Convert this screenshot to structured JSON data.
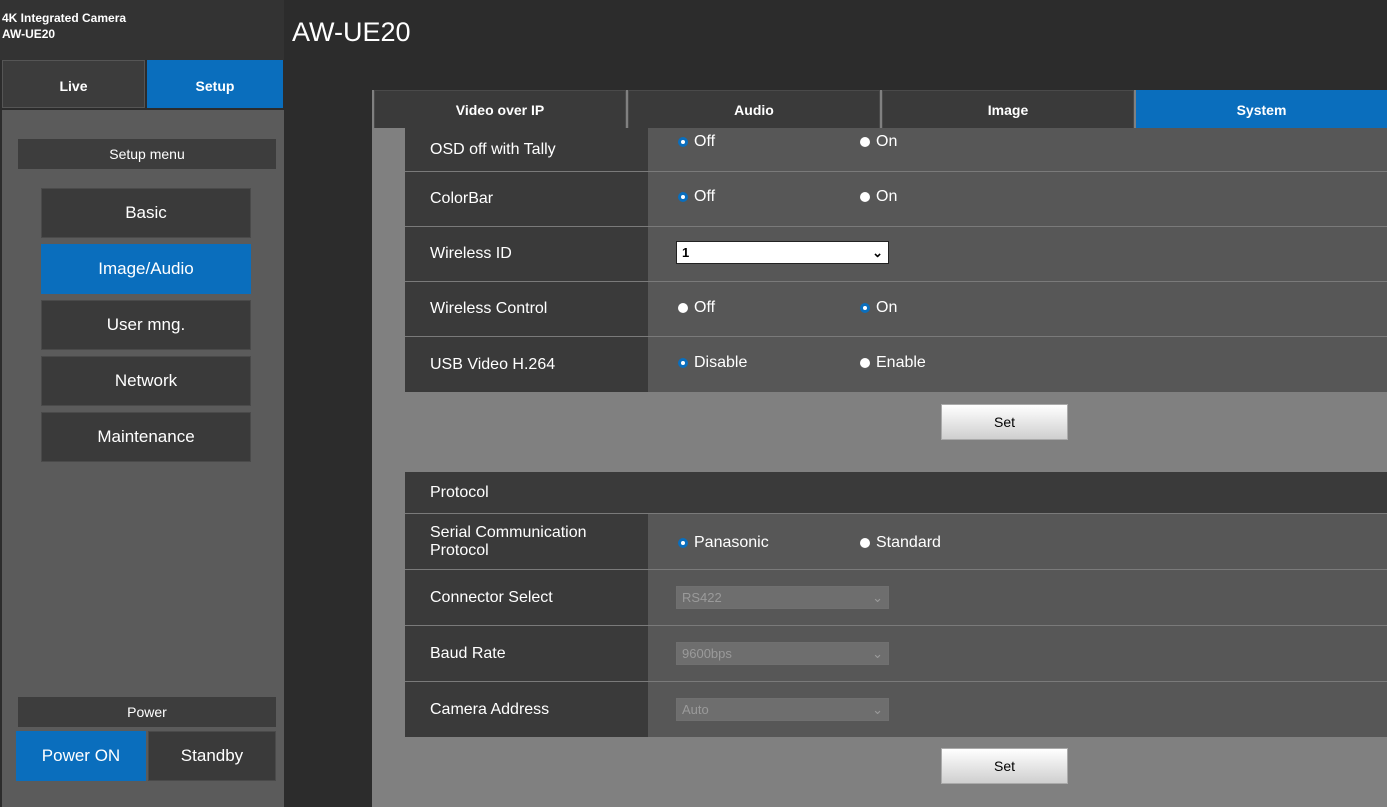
{
  "header": {
    "brand_line1": "4K Integrated Camera",
    "brand_line2": "AW-UE20",
    "model_title": "AW-UE20"
  },
  "mode_tabs": {
    "live": "Live",
    "setup": "Setup",
    "active": "Setup"
  },
  "sidebar": {
    "setup_menu_title": "Setup menu",
    "items": [
      {
        "label": "Basic"
      },
      {
        "label": "Image/Audio"
      },
      {
        "label": "User mng."
      },
      {
        "label": "Network"
      },
      {
        "label": "Maintenance"
      }
    ],
    "active_item": "Image/Audio",
    "power_title": "Power",
    "power_on": "Power ON",
    "standby": "Standby"
  },
  "tabs": [
    {
      "label": "Video over IP"
    },
    {
      "label": "Audio"
    },
    {
      "label": "Image"
    },
    {
      "label": "System"
    }
  ],
  "active_tab": "System",
  "settings": {
    "osd_off_with_tally": {
      "label": "OSD off with Tally",
      "options": [
        "Off",
        "On"
      ],
      "selected": "Off"
    },
    "colorbar": {
      "label": "ColorBar",
      "options": [
        "Off",
        "On"
      ],
      "selected": "Off"
    },
    "wireless_id": {
      "label": "Wireless ID",
      "value": "1"
    },
    "wireless_control": {
      "label": "Wireless Control",
      "options": [
        "Off",
        "On"
      ],
      "selected": "On"
    },
    "usb_video_h264": {
      "label": "USB Video H.264",
      "options": [
        "Disable",
        "Enable"
      ],
      "selected": "Disable"
    },
    "set_label": "Set"
  },
  "protocol": {
    "title": "Protocol",
    "serial_comm": {
      "label_line1": "Serial Communication",
      "label_line2": "Protocol",
      "options": [
        "Panasonic",
        "Standard"
      ],
      "selected": "Panasonic"
    },
    "connector_select": {
      "label": "Connector Select",
      "value": "RS422"
    },
    "baud_rate": {
      "label": "Baud Rate",
      "value": "9600bps"
    },
    "camera_address": {
      "label": "Camera Address",
      "value": "Auto"
    },
    "set_label": "Set"
  },
  "colors": {
    "accent": "#0a6ebd",
    "panel": "#3a3a3a",
    "content_bg": "#808080"
  }
}
